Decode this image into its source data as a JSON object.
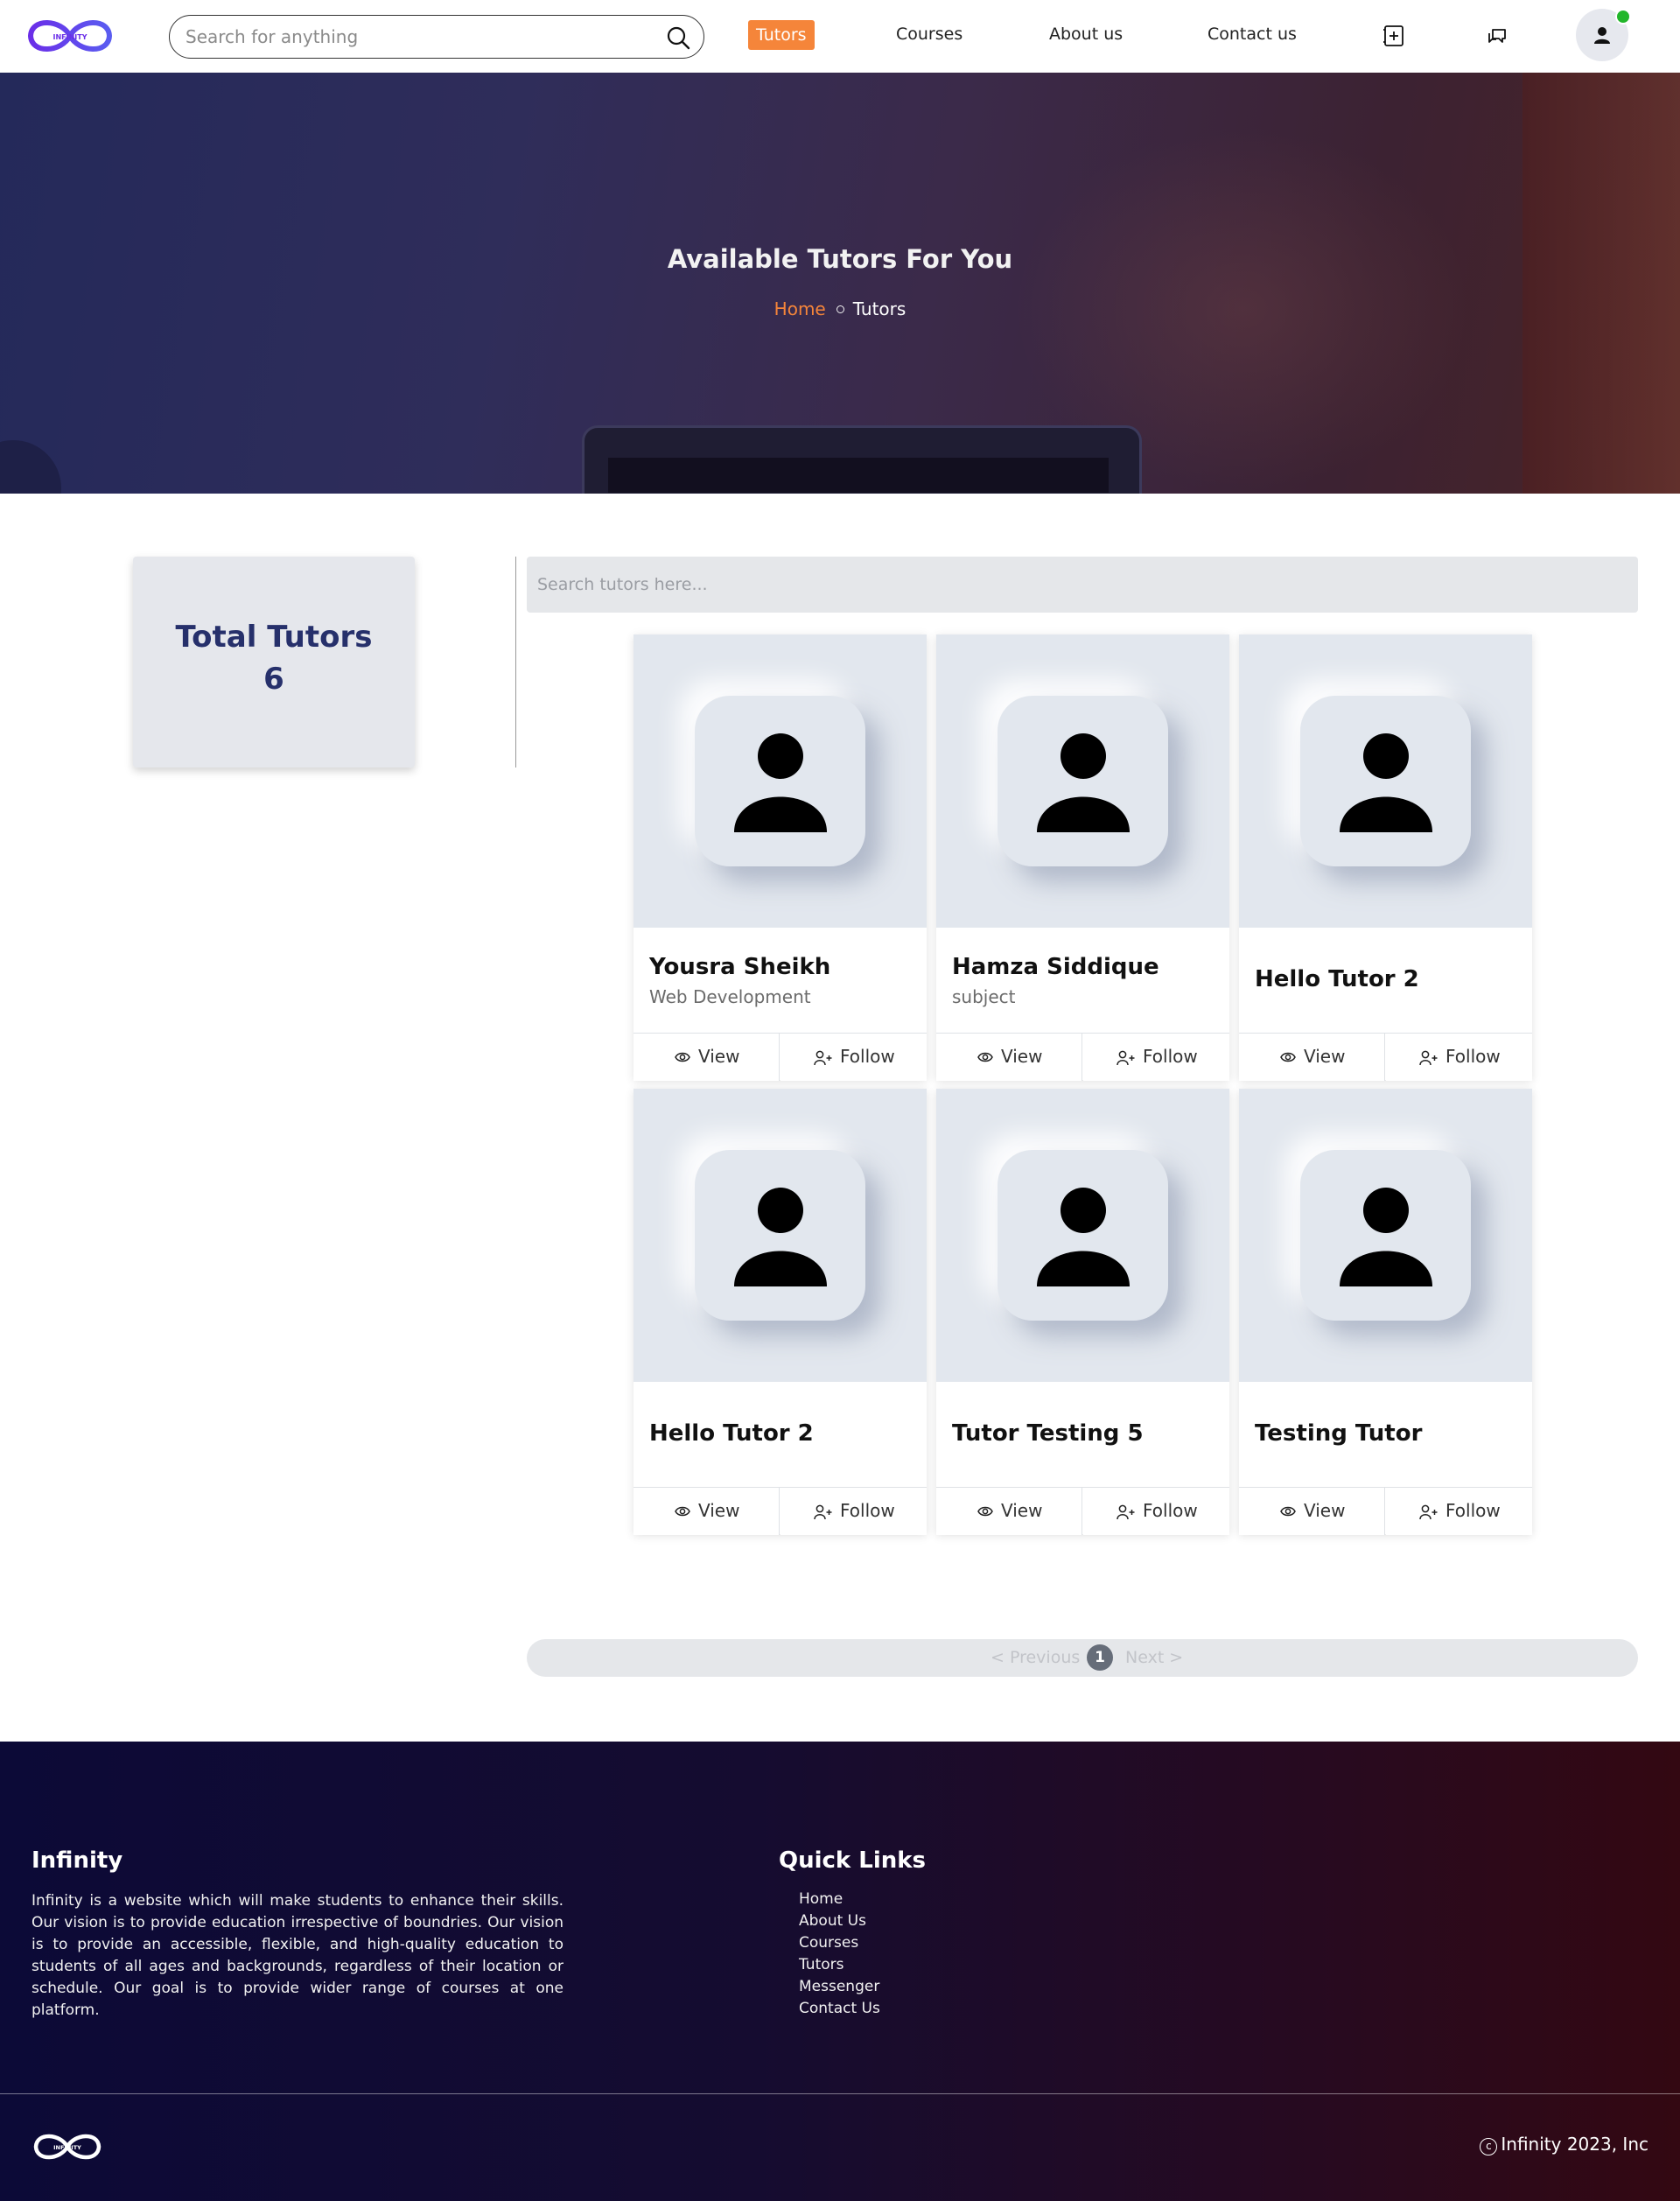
{
  "header": {
    "logo_text": "INFINITY",
    "search_placeholder": "Search for anything",
    "nav": [
      {
        "label": "Tutors",
        "active": true
      },
      {
        "label": "Courses",
        "active": false
      },
      {
        "label": "About us",
        "active": false
      },
      {
        "label": "Contact us",
        "active": false
      }
    ],
    "icons": [
      "add-note-icon",
      "chat-icon",
      "user-avatar-icon"
    ],
    "accent_color": "#f5853a",
    "online_color": "#22b62b"
  },
  "hero": {
    "title": "Available Tutors For You",
    "breadcrumb": {
      "home": "Home",
      "current": "Tutors"
    }
  },
  "stats": {
    "label": "Total Tutors",
    "value": "6"
  },
  "tutor_search": {
    "placeholder": "Search tutors here..."
  },
  "tutors": [
    {
      "name": "Yousra Sheikh",
      "subject": "Web Development",
      "view": "View",
      "follow": "Follow"
    },
    {
      "name": "Hamza Siddique",
      "subject": "subject",
      "view": "View",
      "follow": "Follow"
    },
    {
      "name": "Hello Tutor 2",
      "subject": "",
      "view": "View",
      "follow": "Follow"
    },
    {
      "name": "Hello Tutor 2",
      "subject": "",
      "view": "View",
      "follow": "Follow"
    },
    {
      "name": "Tutor Testing 5",
      "subject": "",
      "view": "View",
      "follow": "Follow"
    },
    {
      "name": "Testing Tutor",
      "subject": "",
      "view": "View",
      "follow": "Follow"
    }
  ],
  "pagination": {
    "previous": "< Previous",
    "page": "1",
    "next": "Next >"
  },
  "footer": {
    "title": "Infinity",
    "about": "Infinity is a website which will make students to enhance their skills. Our vision is to provide education irrespective of boundries. Our vision is to provide an accessible, flexible, and high-quality education to students of all ages and backgrounds, regardless of their location or schedule. Our goal is to provide wider range of courses at one platform.",
    "quick_links_title": "Quick Links",
    "quick_links": [
      "Home",
      "About Us",
      "Courses",
      "Tutors",
      "Messenger",
      "Contact Us"
    ],
    "logo_text": "INFINITY",
    "copyright_mark": "c",
    "copyright": "Infinity 2023, Inc"
  }
}
